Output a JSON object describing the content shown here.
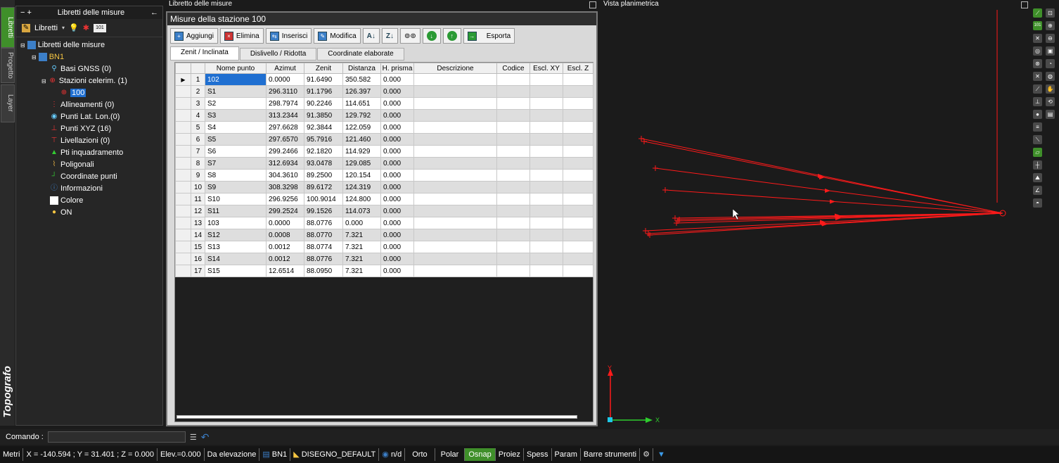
{
  "sidebar_tabs": [
    "Libretti",
    "Progetto",
    "Layer"
  ],
  "brand": "Topografo",
  "tree_panel": {
    "title": "Libretti delle misure",
    "toolbar_label": "Libretti",
    "nodes": [
      {
        "label": "Libretti delle misure"
      },
      {
        "label": "BN1"
      },
      {
        "label": "Basi GNSS (0)"
      },
      {
        "label": "Stazioni celerim. (1)"
      },
      {
        "label": "100"
      },
      {
        "label": "Allineamenti (0)"
      },
      {
        "label": "Punti Lat. Lon.(0)"
      },
      {
        "label": "Punti XYZ (16)"
      },
      {
        "label": "Livellazioni (0)"
      },
      {
        "label": "Pti inquadramento"
      },
      {
        "label": "Poligonali"
      },
      {
        "label": "Coordinate punti"
      },
      {
        "label": "Informazioni"
      },
      {
        "label": "Colore"
      },
      {
        "label": "ON"
      }
    ]
  },
  "window_title": "Libretto delle misure",
  "main": {
    "title": "Misure della stazione 100",
    "toolbar": {
      "add": "Aggiungi",
      "delete": "Elimina",
      "insert": "Inserisci",
      "modify": "Modifica",
      "export": "Esporta"
    },
    "tabs": [
      "Zenit / Inclinata",
      "Dislivello / Ridotta",
      "Coordinate elaborate"
    ],
    "columns": [
      "Nome punto",
      "Azimut",
      "Zenit",
      "Distanza",
      "H. prisma",
      "Descrizione",
      "Codice",
      "Escl. XY",
      "Escl. Z"
    ],
    "rows": [
      [
        "1",
        "102",
        "0.0000",
        "91.6490",
        "350.582",
        "0.000"
      ],
      [
        "2",
        "S1",
        "296.3110",
        "91.1796",
        "126.397",
        "0.000"
      ],
      [
        "3",
        "S2",
        "298.7974",
        "90.2246",
        "114.651",
        "0.000"
      ],
      [
        "4",
        "S3",
        "313.2344",
        "91.3850",
        "129.792",
        "0.000"
      ],
      [
        "5",
        "S4",
        "297.6628",
        "92.3844",
        "122.059",
        "0.000"
      ],
      [
        "6",
        "S5",
        "297.6570",
        "95.7916",
        "121.460",
        "0.000"
      ],
      [
        "7",
        "S6",
        "299.2466",
        "92.1820",
        "114.929",
        "0.000"
      ],
      [
        "8",
        "S7",
        "312.6934",
        "93.0478",
        "129.085",
        "0.000"
      ],
      [
        "9",
        "S8",
        "304.3610",
        "89.2500",
        "120.154",
        "0.000"
      ],
      [
        "10",
        "S9",
        "308.3298",
        "89.6172",
        "124.319",
        "0.000"
      ],
      [
        "11",
        "S10",
        "296.9256",
        "100.9014",
        "124.800",
        "0.000"
      ],
      [
        "12",
        "S11",
        "299.2524",
        "99.1526",
        "114.073",
        "0.000"
      ],
      [
        "13",
        "103",
        "0.0000",
        "88.0776",
        "0.000",
        "0.000"
      ],
      [
        "14",
        "S12",
        "0.0008",
        "88.0770",
        "7.321",
        "0.000"
      ],
      [
        "15",
        "S13",
        "0.0012",
        "88.0774",
        "7.321",
        "0.000"
      ],
      [
        "16",
        "S14",
        "0.0012",
        "88.0776",
        "7.321",
        "0.000"
      ],
      [
        "17",
        "S15",
        "12.6514",
        "88.0950",
        "7.321",
        "0.000"
      ]
    ]
  },
  "plan_view": {
    "title": "Vista planimetrica",
    "axis_x": "X",
    "axis_y": "Y",
    "accent": "#ff1a1a"
  },
  "command": {
    "label": "Comando :"
  },
  "status": {
    "units": "Metri",
    "coords": "X = -140.594 ; Y = 31.401 ; Z = 0.000",
    "elev": "Elev.=0.000",
    "da_elev": "Da elevazione",
    "book": "BN1",
    "layer": "DISEGNO_DEFAULT",
    "nd": "n/d",
    "orto": "Orto",
    "polar": "Polar",
    "osnap": "Osnap",
    "proiez": "Proiez",
    "spess": "Spess",
    "param": "Param",
    "barre": "Barre strumenti"
  }
}
